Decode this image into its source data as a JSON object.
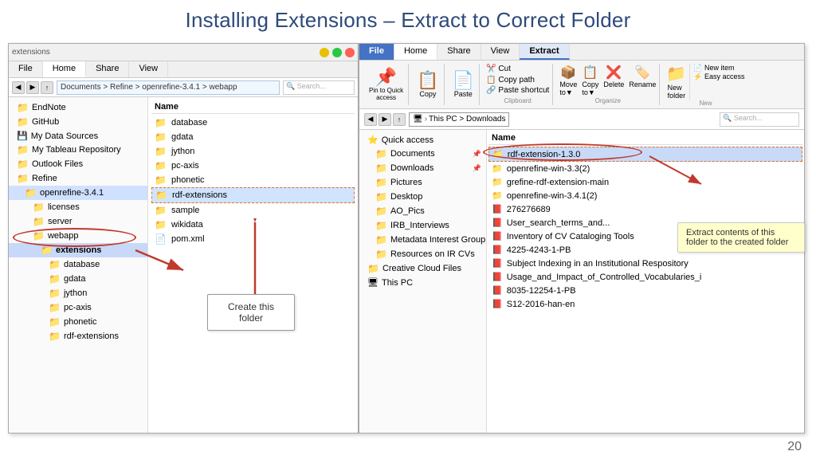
{
  "title": "Installing Extensions – Extract to Correct Folder",
  "left_window": {
    "address": "Documents > Refine > openrefine-3.4.1 > webapp",
    "nav_items": [
      {
        "label": "EndNote",
        "indent": 0,
        "icon": "folder"
      },
      {
        "label": "GitHub",
        "indent": 0,
        "icon": "folder"
      },
      {
        "label": "My Data Sources",
        "indent": 0,
        "icon": "special"
      },
      {
        "label": "My Tableau Repository",
        "indent": 0,
        "icon": "folder"
      },
      {
        "label": "Outlook Files",
        "indent": 0,
        "icon": "folder"
      },
      {
        "label": "Refine",
        "indent": 0,
        "icon": "folder"
      },
      {
        "label": "openrefine-3.4.1",
        "indent": 1,
        "icon": "folder",
        "selected": true
      },
      {
        "label": "licenses",
        "indent": 2,
        "icon": "folder"
      },
      {
        "label": "server",
        "indent": 2,
        "icon": "folder"
      },
      {
        "label": "webapp",
        "indent": 2,
        "icon": "folder"
      },
      {
        "label": "extensions",
        "indent": 3,
        "icon": "folder",
        "selected": true
      },
      {
        "label": "database",
        "indent": 4,
        "icon": "folder"
      },
      {
        "label": "gdata",
        "indent": 4,
        "icon": "folder"
      },
      {
        "label": "jython",
        "indent": 4,
        "icon": "folder"
      },
      {
        "label": "pc-axis",
        "indent": 4,
        "icon": "folder"
      },
      {
        "label": "phonetic",
        "indent": 4,
        "icon": "folder"
      },
      {
        "label": "rdf-extensions",
        "indent": 4,
        "icon": "folder"
      }
    ],
    "file_items": [
      {
        "label": "database",
        "icon": "folder"
      },
      {
        "label": "gdata",
        "icon": "folder"
      },
      {
        "label": "jython",
        "icon": "folder"
      },
      {
        "label": "pc-axis",
        "icon": "folder"
      },
      {
        "label": "phonetic",
        "icon": "folder"
      },
      {
        "label": "rdf-extensions",
        "icon": "folder",
        "selected": true
      },
      {
        "label": "sample",
        "icon": "folder"
      },
      {
        "label": "wikidata",
        "icon": "folder"
      },
      {
        "label": "pom.xml",
        "icon": "xml"
      }
    ],
    "callout": "Create this folder",
    "callout_sub": ""
  },
  "right_window": {
    "tabs": [
      {
        "label": "File",
        "active": false
      },
      {
        "label": "Home",
        "active": false
      },
      {
        "label": "Share",
        "active": false
      },
      {
        "label": "View",
        "active": false
      },
      {
        "label": "Extract",
        "active": true
      }
    ],
    "ribbon_groups": [
      {
        "label": "Clipboard",
        "buttons": [
          {
            "icon": "📌",
            "label": "Pin to Quick\naccess"
          },
          {
            "icon": "📋",
            "label": "Copy"
          },
          {
            "icon": "📄",
            "label": "Paste"
          }
        ]
      },
      {
        "label": "",
        "buttons": [
          {
            "icon": "✂️",
            "label": "Cut"
          },
          {
            "icon": "🗒️",
            "label": "Copy path"
          },
          {
            "icon": "🔗",
            "label": "Paste shortcut"
          }
        ]
      },
      {
        "label": "Organize",
        "buttons": [
          {
            "icon": "➡️",
            "label": "Move\nto"
          },
          {
            "icon": "📋",
            "label": "Copy\nto"
          },
          {
            "icon": "❌",
            "label": "Delete"
          },
          {
            "icon": "🏷️",
            "label": "Rename"
          }
        ]
      },
      {
        "label": "New",
        "buttons": [
          {
            "icon": "📁",
            "label": "New\nfolder"
          },
          {
            "icon": "📄",
            "label": "New item"
          },
          {
            "icon": "⚡",
            "label": "Easy access"
          }
        ]
      }
    ],
    "address": "This PC > Downloads",
    "nav_items": [
      {
        "label": "Quick access",
        "icon": "star"
      },
      {
        "label": "Documents",
        "icon": "folder",
        "indent": 1
      },
      {
        "label": "Downloads",
        "icon": "folder",
        "indent": 1
      },
      {
        "label": "Pictures",
        "icon": "folder",
        "indent": 1
      },
      {
        "label": "Desktop",
        "icon": "folder",
        "indent": 1
      },
      {
        "label": "AO_Pics",
        "icon": "folder",
        "indent": 1
      },
      {
        "label": "IRB_Interviews",
        "icon": "folder",
        "indent": 1
      },
      {
        "label": "Metadata Interest Group",
        "icon": "folder",
        "indent": 1
      },
      {
        "label": "Resources on IR CVs",
        "icon": "folder",
        "indent": 1
      },
      {
        "label": "Creative Cloud Files",
        "icon": "folder",
        "indent": 0
      },
      {
        "label": "This PC",
        "icon": "computer",
        "indent": 0
      }
    ],
    "file_items": [
      {
        "label": "rdf-extension-1.3.0",
        "icon": "folder",
        "selected": true
      },
      {
        "label": "openrefine-win-3.3(2)",
        "icon": "folder"
      },
      {
        "label": "grefine-rdf-extension-main",
        "icon": "folder"
      },
      {
        "label": "openrefine-win-3.4.1(2)",
        "icon": "folder"
      },
      {
        "label": "276276689",
        "icon": "pdf"
      },
      {
        "label": "User_search_terms_and...",
        "icon": "pdf"
      },
      {
        "label": "Inventory of CV Cataloging Tools",
        "icon": "pdf"
      },
      {
        "label": "4225-4243-1-PB",
        "icon": "pdf"
      },
      {
        "label": "Subject Indexing in an Institutional Respository",
        "icon": "pdf"
      },
      {
        "label": "Usage_and_Impact_of_Controlled_Vocabularies_i",
        "icon": "pdf"
      },
      {
        "label": "8035-12254-1-PB",
        "icon": "pdf"
      },
      {
        "label": "S12-2016-han-en",
        "icon": "pdf"
      }
    ],
    "tooltip": "Extract contents of this folder to the created folder"
  },
  "page_number": "20"
}
